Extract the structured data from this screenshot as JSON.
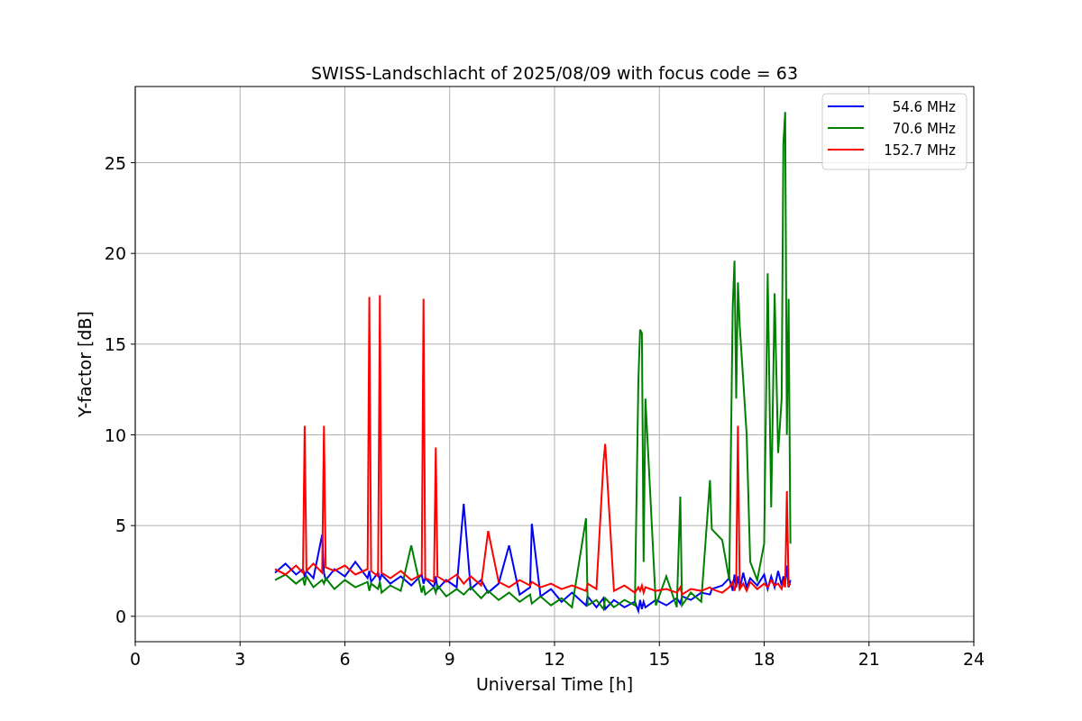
{
  "figure": {
    "chart_data": {
      "type": "line",
      "title": "SWISS-Landschlacht of 2025/08/09 with focus code = 63",
      "xlabel": "Universal Time [h]",
      "ylabel": "Y-factor [dB]",
      "x": [
        4.0,
        4.3,
        4.6,
        4.8,
        4.85,
        4.9,
        5.1,
        5.35,
        5.4,
        5.45,
        5.7,
        6.0,
        6.3,
        6.65,
        6.7,
        6.75,
        6.95,
        7.0,
        7.05,
        7.3,
        7.6,
        7.9,
        8.2,
        8.25,
        8.3,
        8.55,
        8.6,
        8.65,
        8.9,
        9.2,
        9.4,
        9.6,
        9.9,
        10.1,
        10.4,
        10.7,
        11.0,
        11.3,
        11.35,
        11.6,
        11.9,
        12.2,
        12.5,
        12.9,
        12.95,
        13.2,
        13.4,
        13.45,
        13.7,
        14.0,
        14.3,
        14.4,
        14.45,
        14.5,
        14.55,
        14.6,
        14.9,
        15.2,
        15.5,
        15.6,
        15.65,
        15.9,
        16.2,
        16.45,
        16.5,
        16.8,
        17.0,
        17.1,
        17.15,
        17.2,
        17.25,
        17.3,
        17.4,
        17.5,
        17.6,
        17.8,
        18.0,
        18.1,
        18.2,
        18.3,
        18.4,
        18.5,
        18.55,
        18.6,
        18.65,
        18.7,
        18.75
      ],
      "series": [
        {
          "name": "54.6 MHz",
          "color": "#0000ff",
          "values": [
            2.4,
            2.9,
            2.3,
            2.6,
            2.2,
            2.5,
            2.1,
            4.5,
            2.4,
            2.0,
            2.6,
            2.2,
            3.0,
            2.1,
            2.5,
            1.9,
            2.4,
            2.0,
            2.3,
            1.8,
            2.2,
            1.7,
            2.3,
            1.8,
            2.1,
            1.6,
            2.2,
            1.5,
            2.0,
            1.6,
            6.2,
            1.5,
            2.0,
            1.3,
            1.8,
            3.9,
            1.2,
            1.6,
            5.1,
            1.1,
            1.5,
            0.8,
            1.3,
            0.6,
            1.1,
            0.5,
            1.0,
            0.4,
            0.9,
            0.5,
            0.8,
            0.3,
            0.9,
            0.4,
            0.8,
            0.5,
            0.9,
            0.6,
            1.0,
            0.7,
            1.1,
            0.9,
            1.3,
            1.2,
            1.5,
            1.7,
            2.1,
            1.4,
            2.3,
            1.6,
            2.2,
            1.5,
            2.4,
            1.6,
            2.1,
            1.7,
            2.3,
            1.5,
            2.2,
            1.6,
            2.5,
            1.7,
            2.2,
            1.8,
            2.8,
            1.6,
            2.0
          ]
        },
        {
          "name": "70.6 MHz",
          "color": "#008000",
          "values": [
            2.0,
            2.3,
            1.8,
            2.1,
            1.7,
            2.2,
            1.6,
            2.0,
            1.8,
            2.1,
            1.5,
            2.0,
            1.6,
            1.9,
            1.4,
            1.8,
            1.5,
            1.9,
            1.3,
            1.7,
            1.4,
            3.9,
            1.3,
            1.7,
            1.2,
            1.6,
            1.3,
            1.7,
            1.1,
            1.5,
            1.2,
            1.6,
            1.0,
            1.4,
            0.9,
            1.3,
            0.8,
            1.2,
            0.7,
            1.1,
            0.6,
            1.0,
            0.5,
            5.4,
            0.6,
            0.9,
            0.4,
            1.0,
            0.5,
            0.9,
            0.6,
            13.0,
            15.8,
            15.6,
            3.0,
            12.0,
            0.6,
            2.2,
            0.5,
            6.6,
            0.6,
            1.3,
            0.8,
            7.5,
            4.8,
            4.2,
            2.0,
            17.0,
            19.6,
            12.0,
            18.4,
            16.0,
            13.0,
            10.0,
            3.0,
            2.0,
            4.0,
            18.9,
            6.0,
            17.8,
            9.0,
            12.0,
            26.0,
            27.8,
            10.0,
            17.5,
            4.0
          ]
        },
        {
          "name": "152.7 MHz",
          "color": "#ff0000",
          "values": [
            2.6,
            2.3,
            2.8,
            2.4,
            10.5,
            2.5,
            2.9,
            2.4,
            10.5,
            2.7,
            2.5,
            2.8,
            2.3,
            2.6,
            17.6,
            2.5,
            2.2,
            17.7,
            2.4,
            2.1,
            2.5,
            2.0,
            2.3,
            17.5,
            2.1,
            1.9,
            9.3,
            2.2,
            1.9,
            2.3,
            1.8,
            2.2,
            1.7,
            4.7,
            1.9,
            1.6,
            2.0,
            1.7,
            1.9,
            1.6,
            1.8,
            1.5,
            1.7,
            1.4,
            1.8,
            1.5,
            8.5,
            9.5,
            1.4,
            1.7,
            1.3,
            1.6,
            1.4,
            1.7,
            1.3,
            1.6,
            1.4,
            1.5,
            1.3,
            1.6,
            1.2,
            1.5,
            1.4,
            1.6,
            1.5,
            1.3,
            1.6,
            1.9,
            1.4,
            1.8,
            10.5,
            1.5,
            1.8,
            1.4,
            1.9,
            1.5,
            1.8,
            1.6,
            2.0,
            1.7,
            1.8,
            1.5,
            1.9,
            1.6,
            6.9,
            1.7,
            1.8
          ]
        }
      ],
      "xlim": [
        0,
        24
      ],
      "ylim": [
        -1.4,
        29.2
      ],
      "xticks": [
        0,
        3,
        6,
        9,
        12,
        15,
        18,
        21,
        24
      ],
      "yticks": [
        0,
        5,
        10,
        15,
        20,
        25
      ],
      "grid": true,
      "legend": true
    }
  }
}
